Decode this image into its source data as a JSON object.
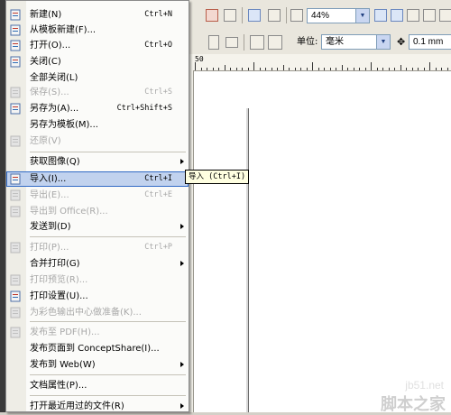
{
  "toolbar": {
    "zoom_value": "44%",
    "unit_label": "单位:",
    "unit_value": "毫米",
    "nudge_value": "0.1 mm"
  },
  "ruler": {
    "label": "50"
  },
  "menu": {
    "items": [
      {
        "label": "新建(N)",
        "shortcut": "Ctrl+N",
        "disabled": false,
        "icon": "new-doc-icon"
      },
      {
        "label": "从模板新建(F)...",
        "shortcut": "",
        "disabled": false,
        "icon": "template-icon"
      },
      {
        "label": "打开(O)...",
        "shortcut": "Ctrl+O",
        "disabled": false,
        "icon": "open-folder-icon"
      },
      {
        "label": "关闭(C)",
        "shortcut": "",
        "disabled": false,
        "icon": "close-doc-icon"
      },
      {
        "label": "全部关闭(L)",
        "shortcut": "",
        "disabled": false,
        "icon": ""
      },
      {
        "label": "保存(S)...",
        "shortcut": "Ctrl+S",
        "disabled": true,
        "icon": "save-icon"
      },
      {
        "label": "另存为(A)...",
        "shortcut": "Ctrl+Shift+S",
        "disabled": false,
        "icon": "save-as-icon"
      },
      {
        "label": "另存为模板(M)...",
        "shortcut": "",
        "disabled": false,
        "icon": ""
      },
      {
        "label": "还原(V)",
        "shortcut": "",
        "disabled": true,
        "icon": "revert-icon"
      },
      {
        "label": "获取图像(Q)",
        "shortcut": "",
        "disabled": false,
        "icon": "",
        "submenu": true
      },
      {
        "label": "导入(I)...",
        "shortcut": "Ctrl+I",
        "disabled": false,
        "icon": "import-icon",
        "highlighted": true
      },
      {
        "label": "导出(E)...",
        "shortcut": "Ctrl+E",
        "disabled": true,
        "icon": "export-icon"
      },
      {
        "label": "导出到 Office(R)...",
        "shortcut": "",
        "disabled": true,
        "icon": "export-office-icon"
      },
      {
        "label": "发送到(D)",
        "shortcut": "",
        "disabled": false,
        "icon": "",
        "submenu": true
      },
      {
        "label": "打印(P)...",
        "shortcut": "Ctrl+P",
        "disabled": true,
        "icon": "print-icon"
      },
      {
        "label": "合并打印(G)",
        "shortcut": "",
        "disabled": false,
        "icon": "",
        "submenu": true
      },
      {
        "label": "打印预览(R)...",
        "shortcut": "",
        "disabled": true,
        "icon": "print-preview-icon"
      },
      {
        "label": "打印设置(U)...",
        "shortcut": "",
        "disabled": false,
        "icon": "print-setup-icon"
      },
      {
        "label": "为彩色输出中心做准备(K)...",
        "shortcut": "",
        "disabled": true,
        "icon": "color-output-icon"
      },
      {
        "label": "发布至 PDF(H)...",
        "shortcut": "",
        "disabled": true,
        "icon": "pdf-icon"
      },
      {
        "label": "发布页面到 ConceptShare(I)...",
        "shortcut": "",
        "disabled": false,
        "icon": ""
      },
      {
        "label": "发布到 Web(W)",
        "shortcut": "",
        "disabled": false,
        "icon": "",
        "submenu": true
      },
      {
        "label": "文档属性(P)...",
        "shortcut": "",
        "disabled": false,
        "icon": ""
      },
      {
        "label": "打开最近用过的文件(R)",
        "shortcut": "",
        "disabled": false,
        "icon": "",
        "submenu": true
      }
    ]
  },
  "tooltip": "导入 (Ctrl+I)",
  "watermark": {
    "site": "jb51.net",
    "brand": "脚本之家"
  },
  "colors": {
    "highlight": "#c1d2ee",
    "highlight_border": "#316ac5",
    "disabled_text": "#a8a8a8"
  }
}
